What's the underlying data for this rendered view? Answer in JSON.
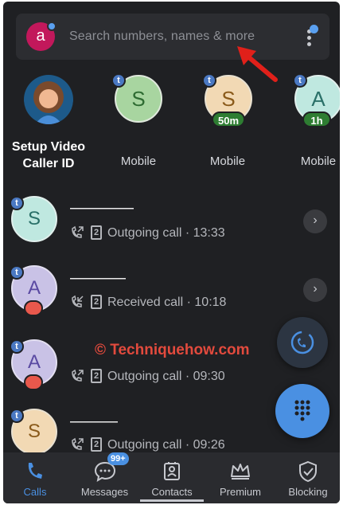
{
  "search": {
    "avatar_letter": "a",
    "placeholder": "Search numbers, names & more"
  },
  "favorites": [
    {
      "label": "Setup Video\nCaller ID",
      "letter": "",
      "badge": ""
    },
    {
      "label": "Mobile",
      "letter": "S",
      "badge": ""
    },
    {
      "label": "Mobile",
      "letter": "S",
      "badge": "50m"
    },
    {
      "label": "Mobile",
      "letter": "A",
      "badge": "1h"
    }
  ],
  "calls": [
    {
      "letter": "S",
      "sim": "2",
      "type": "Outgoing call",
      "time": "13:33"
    },
    {
      "letter": "A",
      "sim": "2",
      "type": "Received call",
      "time": "10:18"
    },
    {
      "letter": "A",
      "sim": "2",
      "type": "Outgoing call",
      "time": "09:30"
    },
    {
      "letter": "S",
      "sim": "2",
      "type": "Outgoing call",
      "time": "09:26"
    }
  ],
  "separator": "·",
  "watermark": "© Techniquehow.com",
  "tbadge_letter": "t",
  "nav": {
    "items": [
      {
        "label": "Calls",
        "icon": "phone-icon"
      },
      {
        "label": "Messages",
        "icon": "chat-icon",
        "badge": "99+"
      },
      {
        "label": "Contacts",
        "icon": "contact-card-icon"
      },
      {
        "label": "Premium",
        "icon": "crown-icon"
      },
      {
        "label": "Blocking",
        "icon": "shield-check-icon"
      }
    ]
  },
  "colors": {
    "accent": "#4a90e2",
    "background": "#1f2023",
    "premium_green": "#2e7d32",
    "alert_red": "#e8584c"
  }
}
